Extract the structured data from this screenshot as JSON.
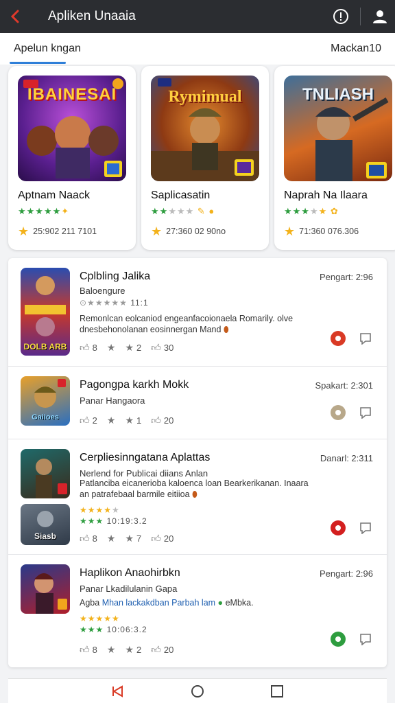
{
  "app": {
    "title": "Apliken Unaaia"
  },
  "tabs": {
    "left": "Apelun kngan",
    "right": "Mackan10"
  },
  "featured": [
    {
      "art_title": "IBAINESAI",
      "name": "Aptnam Naack",
      "meta": "25:902 211 7101",
      "star_color": "#2e9d3f"
    },
    {
      "art_title": "Rymimual",
      "name": "Saplicasatin",
      "meta": "27:360 02 90no",
      "star_color": "#2e9d3f"
    },
    {
      "art_title": "TNLIASH",
      "name": "Naprah Na Ilaara",
      "meta": "71:360 076.306",
      "star_color": "#2e9d3f"
    }
  ],
  "items": [
    {
      "title": "Cplbling Jalika",
      "sub": "Baloengure",
      "rating_text": "11:1",
      "desc": "Remonlcan eolcaniod engeanfacoionaela Romarily. olve dnesbehonolanan eosinnergan Mand",
      "date": "Pengart: 2:96",
      "likes": "8",
      "stars": "2",
      "count": "30",
      "status_color": "#d93a25",
      "thumb_label": "DOLB ARB"
    },
    {
      "title": "Pagongpa karkh Mokk",
      "sub": "Panar Hangaora",
      "date": "Spakart: 2:301",
      "likes": "2",
      "stars": "1",
      "count": "20",
      "status_color": "#b8a88a",
      "thumb_label": "Gaiioes"
    },
    {
      "title": "Cerpliesinngatana Aplattas",
      "sub": "Nerlend for Publicai diians Anlan",
      "desc": "Patlanciba eicanerioba kaloenca loan Bearkerikanan. Inaara an patrafebaal barmile eitiioa",
      "rating_text": "10:19:3.2",
      "date": "Danarl: 2:311",
      "likes": "8",
      "stars": "7",
      "count": "20",
      "status_color": "#d31f1f",
      "thumb_label": "Siasb"
    },
    {
      "title": "Haplikon Anaohirbkn",
      "sub": "Panar Lkadilulanin Gapa",
      "desc_plain": "Agba",
      "desc_link": "Mhan lackakdban Parbah lam",
      "desc_tail": "eMbka.",
      "rating_text": "10:06:3.2",
      "date": "Pengart: 2:96",
      "likes": "8",
      "stars": "2",
      "count": "20",
      "status_color": "#2e9d3f"
    }
  ]
}
